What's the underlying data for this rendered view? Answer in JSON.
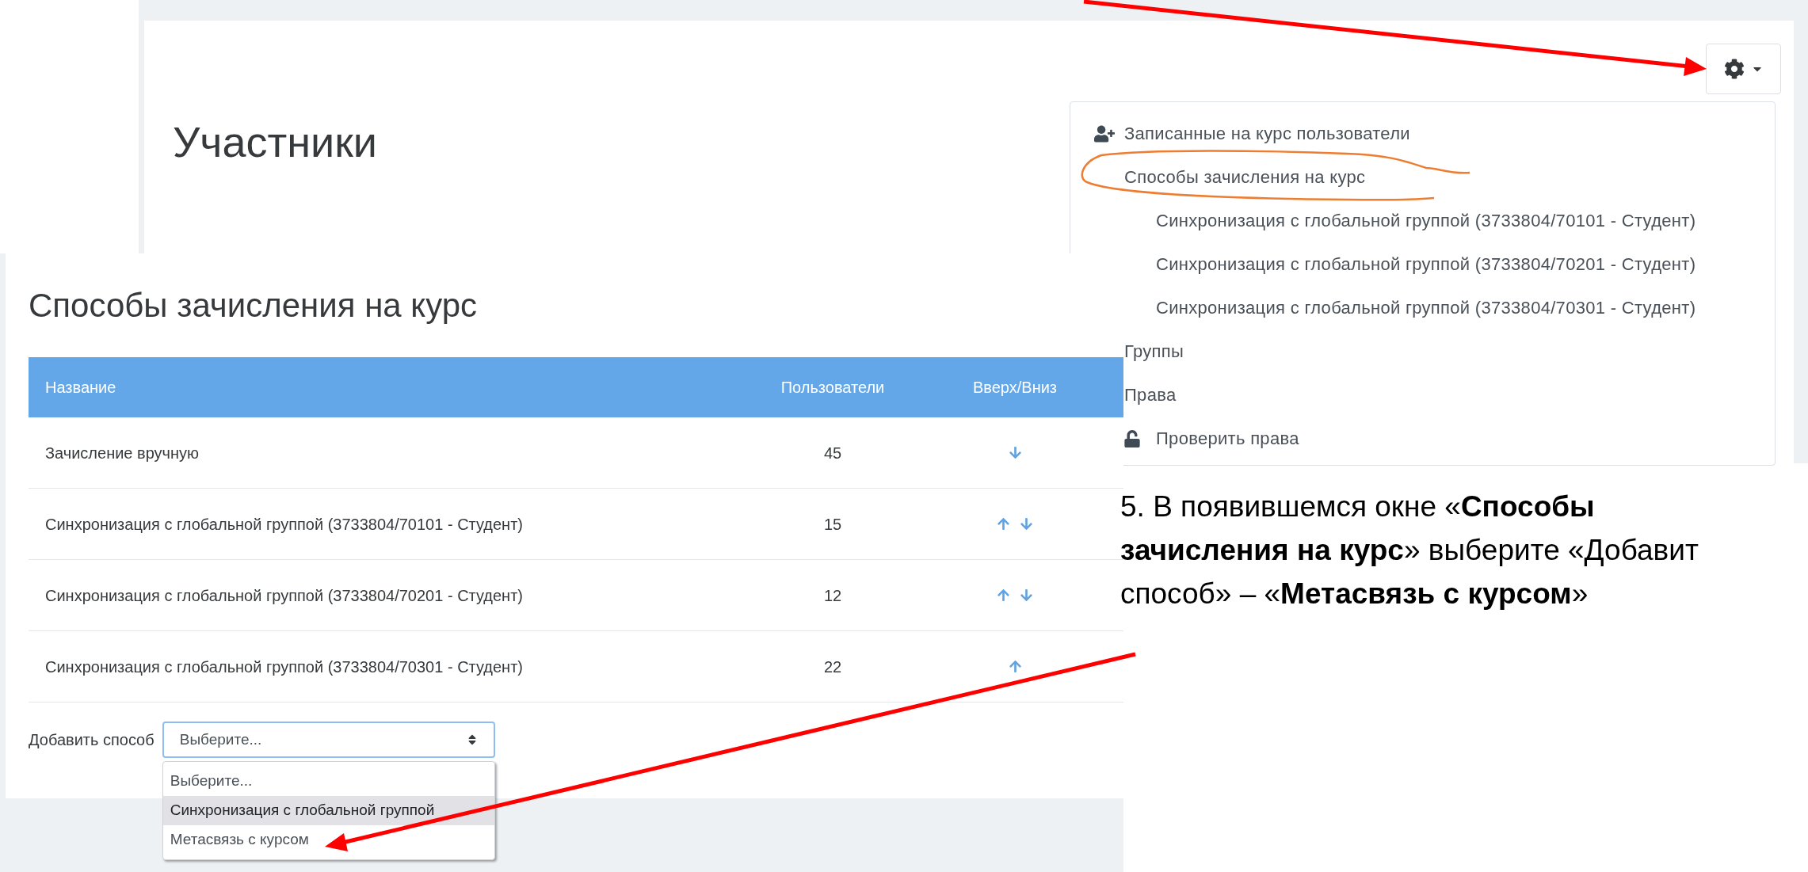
{
  "participants_screen": {
    "page_title": "Участники",
    "settings_menu": {
      "items": [
        {
          "label": "Записанные на курс пользователи",
          "kind": "user-plus"
        },
        {
          "label": "Способы зачисления на курс",
          "kind": "plain",
          "children": [
            {
              "label": "Синхронизация с глобальной группой (3733804/70101 - Студент)",
              "kind": "plain"
            },
            {
              "label": "Синхронизация с глобальной группой (3733804/70201 - Студент)",
              "kind": "plain"
            },
            {
              "label": "Синхронизация с глобальной группой (3733804/70301 - Студент)",
              "kind": "plain"
            }
          ]
        },
        {
          "label": "Группы",
          "kind": "plain"
        },
        {
          "label": "Права",
          "kind": "plain",
          "children": [
            {
              "label": "Проверить права",
              "kind": "lock"
            }
          ]
        }
      ]
    }
  },
  "enrolment_screen": {
    "page_title": "Способы зачисления на курс",
    "table": {
      "columns": [
        "Название",
        "Пользователи",
        "Вверх/Вниз"
      ],
      "rows": [
        {
          "name": "Зачисление вручную",
          "users": "45",
          "move_up": false,
          "move_down": true
        },
        {
          "name": "Синхронизация с глобальной группой (3733804/70101 - Студент)",
          "users": "15",
          "move_up": true,
          "move_down": true
        },
        {
          "name": "Синхронизация с глобальной группой (3733804/70201 - Студент)",
          "users": "12",
          "move_up": true,
          "move_down": true
        },
        {
          "name": "Синхронизация с глобальной группой (3733804/70301 - Студент)",
          "users": "22",
          "move_up": true,
          "move_down": false
        }
      ]
    },
    "add_method": {
      "label": "Добавить способ",
      "value": "Выберите...",
      "options": [
        {
          "label": "Выберите...",
          "highlighted": false
        },
        {
          "label": "Синхронизация с глобальной группой",
          "highlighted": true
        },
        {
          "label": "Метасвязь с курсом",
          "highlighted": false
        }
      ]
    }
  },
  "instruction": {
    "lines": [
      "5. В появившемся окне «**Способы**",
      "**зачисления на курс**» выберите «Добавит",
      "способ» – «**Метасвязь с курсом**»"
    ]
  }
}
